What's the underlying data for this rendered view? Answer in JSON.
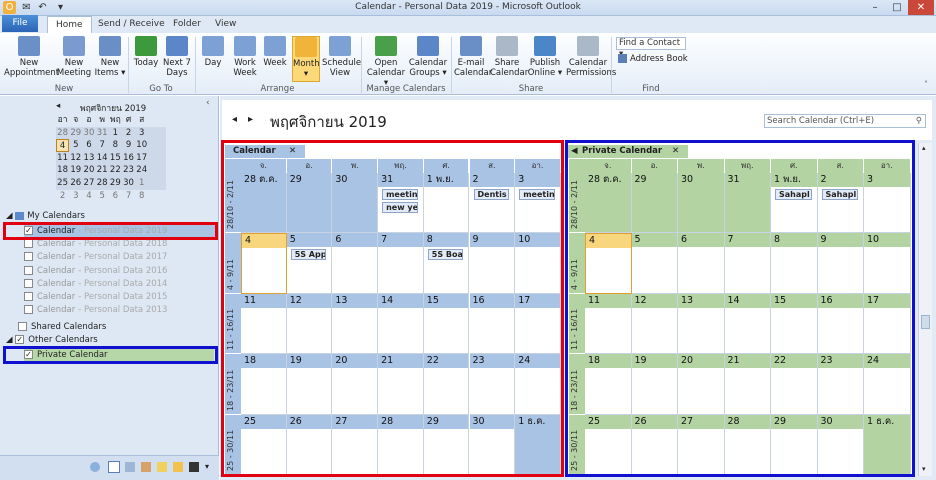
{
  "window": {
    "title": "Calendar - Personal Data 2019  -  Microsoft Outlook"
  },
  "ribbon_tabs": [
    "File",
    "Home",
    "Send / Receive",
    "Folder",
    "View"
  ],
  "ribbon": {
    "buttons": [
      {
        "label1": "New",
        "label2": "Appointment",
        "icon": "new-appointment-icon"
      },
      {
        "label1": "New",
        "label2": "Meeting",
        "icon": "new-meeting-icon"
      },
      {
        "label1": "New",
        "label2": "Items ▾",
        "icon": "new-items-icon"
      },
      {
        "label1": "Today",
        "label2": "",
        "icon": "today-icon"
      },
      {
        "label1": "Next 7",
        "label2": "Days",
        "icon": "next-7-days-icon"
      },
      {
        "label1": "Day",
        "label2": "",
        "icon": "day-view-icon"
      },
      {
        "label1": "Work",
        "label2": "Week",
        "icon": "work-week-icon"
      },
      {
        "label1": "Week",
        "label2": "",
        "icon": "week-view-icon"
      },
      {
        "label1": "Month",
        "label2": "▾",
        "icon": "month-view-icon"
      },
      {
        "label1": "Schedule",
        "label2": "View",
        "icon": "schedule-view-icon"
      },
      {
        "label1": "Open",
        "label2": "Calendar ▾",
        "icon": "open-calendar-icon"
      },
      {
        "label1": "Calendar",
        "label2": "Groups ▾",
        "icon": "calendar-groups-icon"
      },
      {
        "label1": "E-mail",
        "label2": "Calendar",
        "icon": "email-calendar-icon"
      },
      {
        "label1": "Share",
        "label2": "Calendar",
        "icon": "share-calendar-icon"
      },
      {
        "label1": "Publish",
        "label2": "Online ▾",
        "icon": "publish-online-icon"
      },
      {
        "label1": "Calendar",
        "label2": "Permissions",
        "icon": "calendar-permissions-icon"
      }
    ],
    "groups": [
      "New",
      "Go To",
      "Arrange",
      "Manage Calendars",
      "Share",
      "Find"
    ],
    "find_contact": "Find a Contact",
    "address_book": "Address Book"
  },
  "minical": {
    "month": "พฤศจิกายน 2019",
    "dow": [
      "อา",
      "จ",
      "อ",
      "พ",
      "พฤ",
      "ศ",
      "ส"
    ],
    "weeks": [
      [
        "28",
        "29",
        "30",
        "31",
        "1",
        "2",
        "3"
      ],
      [
        "4",
        "5",
        "6",
        "7",
        "8",
        "9",
        "10"
      ],
      [
        "11",
        "12",
        "13",
        "14",
        "15",
        "16",
        "17"
      ],
      [
        "18",
        "19",
        "20",
        "21",
        "22",
        "23",
        "24"
      ],
      [
        "25",
        "26",
        "27",
        "28",
        "29",
        "30",
        "1"
      ],
      [
        "2",
        "3",
        "4",
        "5",
        "6",
        "7",
        "8"
      ]
    ]
  },
  "nav": {
    "my_calendars": "My Calendars",
    "shared_calendars": "Shared Calendars",
    "other_calendars": "Other Calendars",
    "calendars": [
      {
        "name": "Calendar",
        "sub": "- Personal Data 2019",
        "checked": "✓"
      },
      {
        "name": "Calendar",
        "sub": "- Personal Data 2018",
        "checked": ""
      },
      {
        "name": "Calendar",
        "sub": "- Personal Data 2017",
        "checked": ""
      },
      {
        "name": "Calendar",
        "sub": "- Personal Data 2016",
        "checked": ""
      },
      {
        "name": "Calendar",
        "sub": "- Personal Data 2014",
        "checked": ""
      },
      {
        "name": "Calendar",
        "sub": "- Personal Data 2015",
        "checked": ""
      },
      {
        "name": "Calendar",
        "sub": "- Personal Data 2013",
        "checked": ""
      }
    ],
    "private_calendar": "Private Calendar"
  },
  "main": {
    "month_title": "พฤศจิกายน 2019",
    "search_placeholder": "Search Calendar (Ctrl+E)",
    "dow": [
      "จ.",
      "อ.",
      "พ.",
      "พฤ.",
      "ศ.",
      "ส.",
      "อา."
    ],
    "week_labels": [
      "28/10 - 2/11",
      "4 - 9/11",
      "11 - 16/11",
      "18 - 23/11",
      "25 - 30/11"
    ],
    "weeks": [
      [
        "28 ต.ค.",
        "29",
        "30",
        "31",
        "1 พ.ย.",
        "2",
        "3"
      ],
      [
        "4",
        "5",
        "6",
        "7",
        "8",
        "9",
        "10"
      ],
      [
        "11",
        "12",
        "13",
        "14",
        "15",
        "16",
        "17"
      ],
      [
        "18",
        "19",
        "20",
        "21",
        "22",
        "23",
        "24"
      ],
      [
        "25",
        "26",
        "27",
        "28",
        "29",
        "30",
        "1 ธ.ค."
      ]
    ],
    "calendar_tab": "Calendar",
    "private_tab": "Private Calendar",
    "appts_left": [
      {
        "w": 0,
        "d": 3,
        "row": 0,
        "text": "meetin"
      },
      {
        "w": 0,
        "d": 3,
        "row": 1,
        "text": "new ye"
      },
      {
        "w": 0,
        "d": 5,
        "row": 0,
        "text": "Dentis"
      },
      {
        "w": 0,
        "d": 6,
        "row": 0,
        "text": "meetin"
      },
      {
        "w": 1,
        "d": 1,
        "row": 0,
        "text": "5S App"
      },
      {
        "w": 1,
        "d": 4,
        "row": 0,
        "text": "5S Boa"
      }
    ],
    "appts_right": [
      {
        "w": 0,
        "d": 4,
        "row": 0,
        "text": "Sahapl"
      },
      {
        "w": 0,
        "d": 5,
        "row": 0,
        "text": "Sahapl"
      }
    ]
  },
  "colors": {
    "left_shade": "#a9c3e4",
    "right_shade": "#b3d3a2",
    "red": "#e0000f",
    "blue": "#1010d0"
  }
}
